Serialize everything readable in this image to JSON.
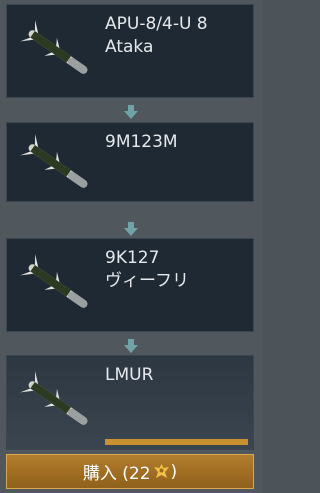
{
  "modifications": [
    {
      "name": "APU-8/4-U 8\nAtaka",
      "line1": "APU-8/4-U 8",
      "line2": "Ataka",
      "icon": "missile-icon"
    },
    {
      "name": "9M123M",
      "line1": "9M123M",
      "line2": "",
      "icon": "missile-icon"
    },
    {
      "name": "9K127 ヴィーフリ",
      "line1": "9K127",
      "line2": "ヴィーフリ",
      "icon": "missile-icon"
    },
    {
      "name": "LMUR",
      "line1": "LMUR",
      "line2": "",
      "icon": "missile-icon",
      "research_progress": 0.98
    }
  ],
  "buy_button": {
    "label_prefix": "購入 (22",
    "label_suffix": ")",
    "currency_icon": "golden-eagle-icon"
  },
  "colors": {
    "accent": "#c9912f",
    "arrow": "#6fa3a8",
    "card_bg": "#1f2933"
  }
}
